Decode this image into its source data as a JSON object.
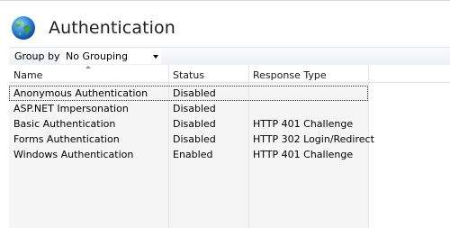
{
  "page": {
    "title": "Authentication",
    "icon": "globe-icon"
  },
  "toolbar": {
    "group_by_label": "Group by:",
    "group_by_value": "No Grouping"
  },
  "table": {
    "columns": [
      "Name",
      "Status",
      "Response Type"
    ],
    "sorted_column": "Name",
    "rows": [
      {
        "name": "Anonymous Authentication",
        "status": "Disabled",
        "response_type": "",
        "selected": true
      },
      {
        "name": "ASP.NET Impersonation",
        "status": "Disabled",
        "response_type": ""
      },
      {
        "name": "Basic Authentication",
        "status": "Disabled",
        "response_type": "HTTP 401 Challenge"
      },
      {
        "name": "Forms Authentication",
        "status": "Disabled",
        "response_type": "HTTP 302 Login/Redirect"
      },
      {
        "name": "Windows Authentication",
        "status": "Enabled",
        "response_type": "HTTP 401 Challenge"
      }
    ]
  },
  "colors": {
    "title_text": "#1e1e1e",
    "column_bg": "#f5f5f5",
    "toolbar_bg": "#eef0f4"
  }
}
